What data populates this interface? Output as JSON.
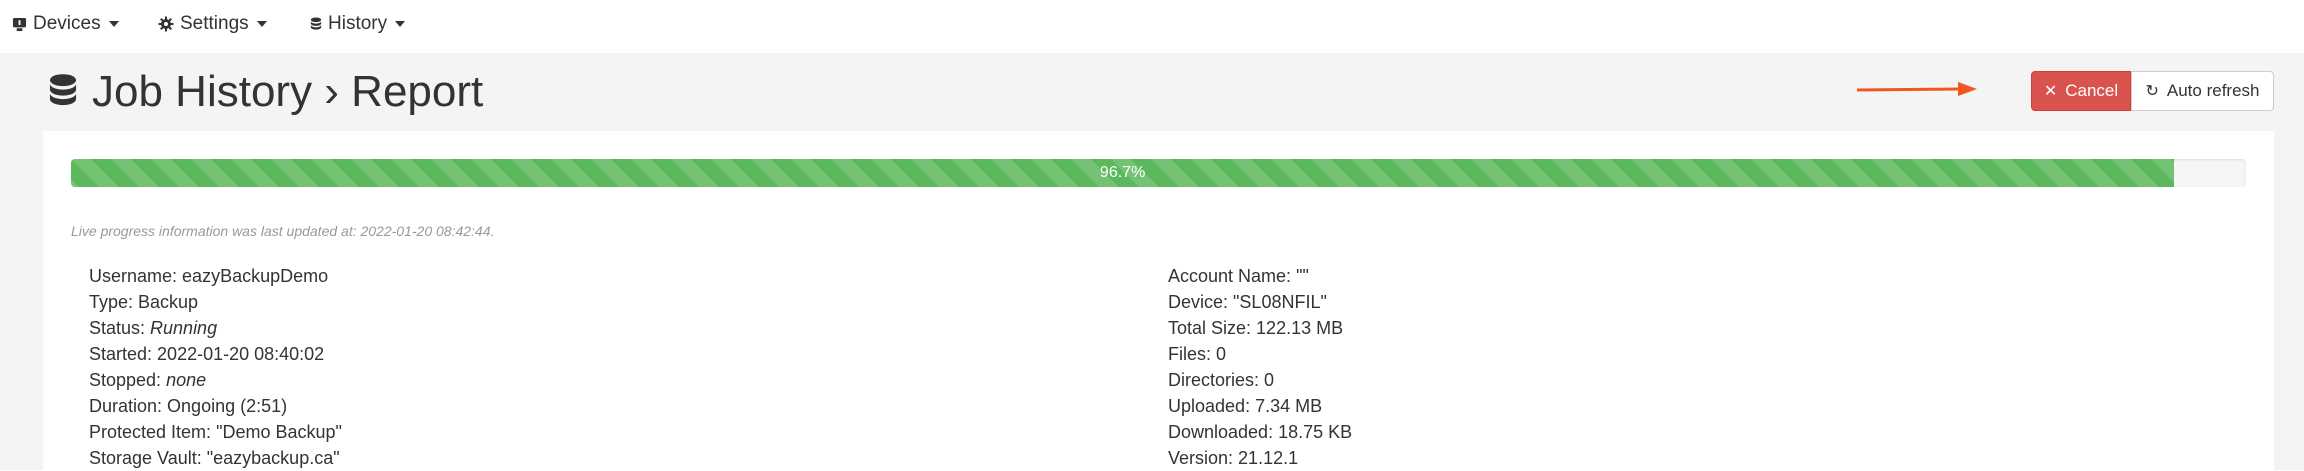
{
  "nav": {
    "items": [
      {
        "label": "Devices",
        "icon": "device-icon"
      },
      {
        "label": "Settings",
        "icon": "gear-icon"
      },
      {
        "label": "History",
        "icon": "database-icon"
      }
    ]
  },
  "page": {
    "title": "Job History › Report"
  },
  "actions": {
    "cancel_label": "Cancel",
    "refresh_label": "Auto refresh"
  },
  "progress": {
    "percent": 96.7,
    "label": "96.7%",
    "color": "#5cb85c"
  },
  "updated_text": "Live progress information was last updated at: 2022-01-20 08:42:44.",
  "details_left": [
    {
      "label": "Username: ",
      "value": "eazyBackupDemo",
      "italic": false
    },
    {
      "label": "Type: ",
      "value": "Backup",
      "italic": false
    },
    {
      "label": "Status: ",
      "value": "Running",
      "italic": true
    },
    {
      "label": "Started: ",
      "value": "2022-01-20 08:40:02",
      "italic": false
    },
    {
      "label": "Stopped: ",
      "value": "none",
      "italic": true
    },
    {
      "label": "Duration: ",
      "value": "Ongoing (2:51)",
      "italic": false
    },
    {
      "label": "Protected Item: ",
      "value": "\"Demo Backup\"",
      "italic": false
    },
    {
      "label": "Storage Vault: ",
      "value": "\"eazybackup.ca\"",
      "italic": false
    }
  ],
  "details_right": [
    {
      "label": "Account Name: ",
      "value": "\"\"",
      "italic": false
    },
    {
      "label": "Device: ",
      "value": "\"SL08NFIL\"",
      "italic": false
    },
    {
      "label": "Total Size: ",
      "value": "122.13 MB",
      "italic": false
    },
    {
      "label": "Files: ",
      "value": "0",
      "italic": false
    },
    {
      "label": "Directories: ",
      "value": "0",
      "italic": false
    },
    {
      "label": "Uploaded: ",
      "value": "7.34 MB",
      "italic": false
    },
    {
      "label": "Downloaded: ",
      "value": "18.75 KB",
      "italic": false
    },
    {
      "label": "Version: ",
      "value": "21.12.1",
      "italic": false
    }
  ],
  "colors": {
    "cancel": "#d9534f",
    "arrow": "#f0561e"
  }
}
